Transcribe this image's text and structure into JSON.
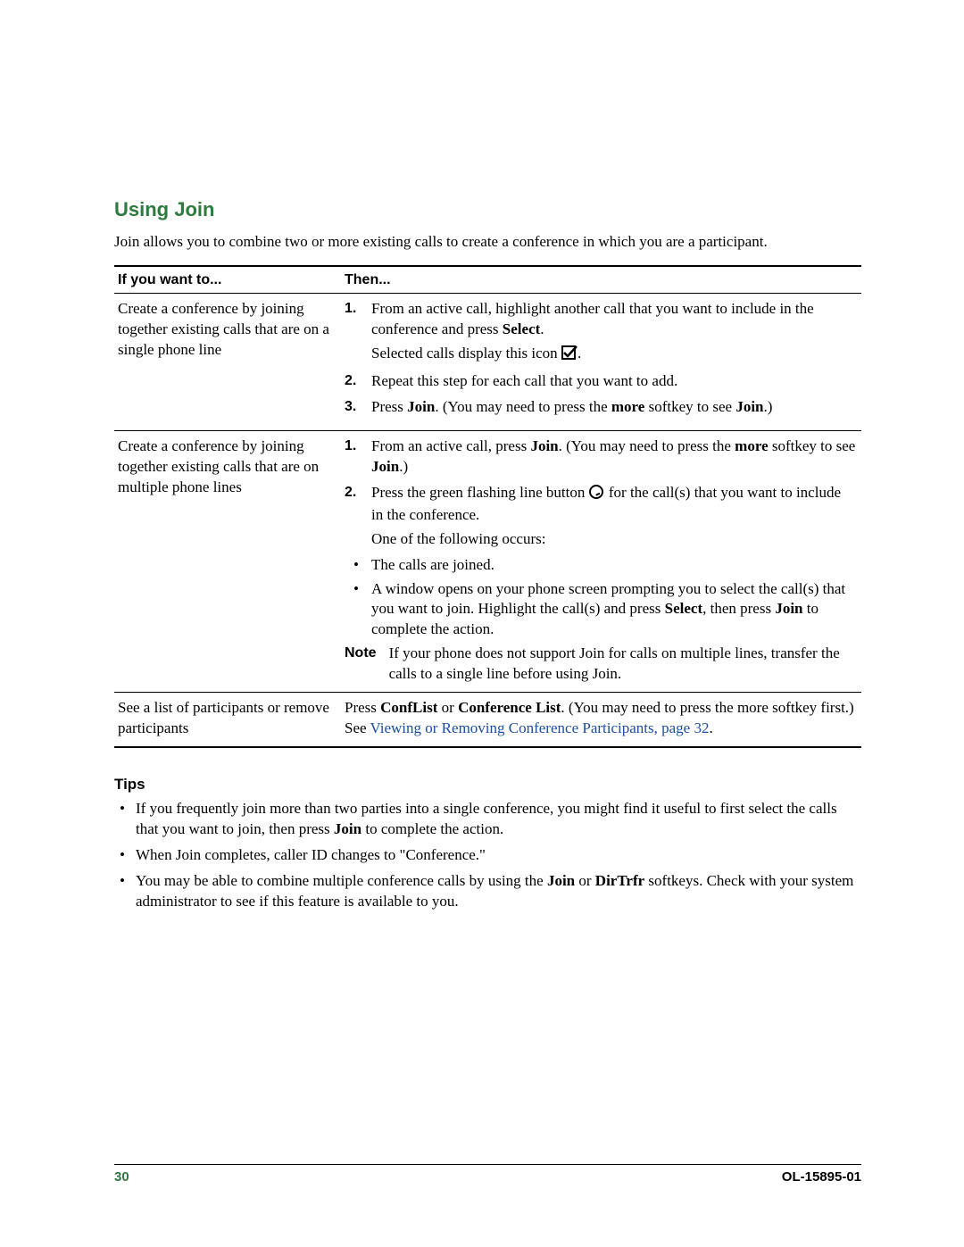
{
  "heading": "Using Join",
  "intro": "Join allows you to combine two or more existing calls to create a conference in which you are a participant.",
  "table": {
    "header_left": "If you want to...",
    "header_right": "Then...",
    "rows": [
      {
        "left": "Create a conference by joining together existing calls that are on a single phone line",
        "steps": [
          {
            "n": "1.",
            "t1": "From an active call, highlight another call that you want to include in the conference and press ",
            "b1": "Select",
            "t2": "."
          },
          {
            "sub_t1": "Selected calls display this icon ",
            "icon": "check",
            "sub_t2": "."
          },
          {
            "n": "2.",
            "t1": "Repeat this step for each call that you want to add."
          },
          {
            "n": "3.",
            "t1": "Press ",
            "b1": "Join",
            "t2": ". (You may need to press the ",
            "b2": "more",
            "t3": " softkey to see ",
            "b3": "Join",
            "t4": ".)"
          }
        ]
      },
      {
        "left": "Create a conference by joining together existing calls that are on multiple phone lines",
        "steps2": [
          {
            "n": "1.",
            "t1": "From an active call, press ",
            "b1": "Join",
            "t2": ". (You may need to press the ",
            "b2": "more",
            "t3": " softkey to see ",
            "b3": "Join",
            "t4": ".)"
          },
          {
            "n": "2.",
            "t1": "Press the green flashing line button ",
            "icon": "line",
            "t2": " for the call(s) that you want to include in the conference."
          }
        ],
        "one_of": "One of the following occurs:",
        "bullets": [
          {
            "t1": "The calls are joined."
          },
          {
            "t1": "A window opens on your phone screen prompting you to select the call(s) that you want to join. Highlight the call(s) and press ",
            "b1": "Select",
            "t2": ", then press ",
            "b2": "Join",
            "t3": " to complete the action."
          }
        ],
        "note_label": "Note",
        "note_body": "If your phone does not support Join for calls on multiple lines, transfer the calls to a single line before using Join."
      },
      {
        "left": "See a list of participants or remove participants",
        "r3_t1": "Press ",
        "r3_b1": "ConfList",
        "r3_t2": " or ",
        "r3_b2": "Conference List",
        "r3_t3": ". (You may need to press the more softkey first.) See ",
        "r3_link": "Viewing or Removing Conference Participants, page 32",
        "r3_t4": "."
      }
    ]
  },
  "tips_heading": "Tips",
  "tips": [
    {
      "t1": "If you frequently join more than two parties into a single conference, you might find it useful to first select the calls that you want to join, then press ",
      "b1": "Join",
      "t2": " to complete the action."
    },
    {
      "t1": "When Join completes, caller ID changes to \"Conference.\""
    },
    {
      "t1": "You may be able to combine multiple conference calls by using the ",
      "b1": "Join",
      "t2": " or ",
      "b2": "DirTrfr",
      "t3": " softkeys. Check with your system administrator to see if this feature is available to you."
    }
  ],
  "footer": {
    "page": "30",
    "doc": "OL-15895-01"
  }
}
